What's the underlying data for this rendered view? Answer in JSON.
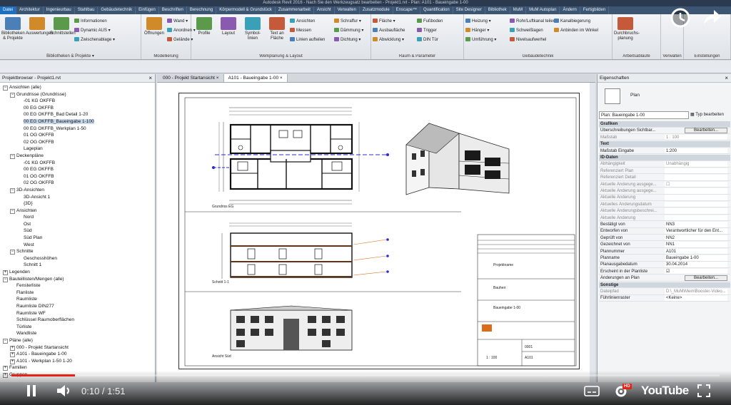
{
  "window": {
    "title": "Autodesk Revit 2016 - Nach Sie den Werkzeugsatz bearbeiten - Projekt1.rvt - Plan: A101 - Baueingabe 1-00"
  },
  "ribbon_tabs": [
    "Datei",
    "Architektur",
    "Ingenieurbau",
    "Stahlbau",
    "Gebäudetechnik",
    "Einfügen",
    "Beschriften",
    "Berechnung",
    "Körpermodell & Grundstück",
    "Zusammenarbeit",
    "Ansicht",
    "Verwalten",
    "Zusatzmodule",
    "Enscape™",
    "Quantification",
    "Site Designer",
    "Bibliothek",
    "MuM",
    "MuM Autoplan",
    "Ändern",
    "Fertigbilden"
  ],
  "ribbon": {
    "groups": [
      {
        "title": "Bibliotheken & Projekte ▾",
        "big": [
          "Bibliotheken & Projekte",
          "Auswertungen",
          "Schnittstellen"
        ],
        "small": [
          "Informationen",
          "Dynamic AUS ▾",
          "Zwischenablage ▾"
        ]
      },
      {
        "title": "Modellierung",
        "big": [
          "Öffnungen"
        ],
        "small": [
          "Wand ▾",
          "Anordnen ▾",
          "Gelände ▾"
        ]
      },
      {
        "title": "Werkplanung & Layout",
        "big": [
          "Profile",
          "Layout",
          "Symbol-linien",
          "Text an Fläche"
        ],
        "small": [
          "Ansichten",
          "Messen",
          "Linien aufteilen",
          "Schraffur ▾",
          "Dämmung ▾",
          "Dichtung ▾"
        ]
      },
      {
        "title": "Raum & Parameter",
        "big": [],
        "small": [
          "Fläche ▾",
          "Ausbaufläche",
          "Abwicklung ▾",
          "Fußboden",
          "Trigger",
          "DIN Tür"
        ]
      },
      {
        "title": "Gebäudetechnik",
        "big": [],
        "small": [
          "Heizung ▾",
          "Hänger ▾",
          "Umführung ▾",
          "Rohr/Luftkanal teilen",
          "Schweißlagen",
          "Nivelsaufwerhel",
          "Kanalbiegerung",
          "Anbinden im Winkel"
        ]
      },
      {
        "title": "Arbeitsabläufe",
        "big": [
          "Durchbruchs-planung"
        ],
        "small": []
      },
      {
        "title": "Verwalten",
        "big": [],
        "small": []
      },
      {
        "title": "Einstellungen",
        "big": [],
        "small": []
      }
    ]
  },
  "browser": {
    "title": "Projektbrowser - Projekt1.rvt",
    "items": [
      {
        "label": "Ansichten (alle)",
        "level": 0,
        "toggle": "−"
      },
      {
        "label": "Grundrisse (Grundrisse)",
        "level": 1,
        "toggle": "−"
      },
      {
        "label": "-01 KG OKFFB",
        "level": 2
      },
      {
        "label": "00 EG OKFFB",
        "level": 2
      },
      {
        "label": "00 EG OKFFB_Bad Detail 1-20",
        "level": 2
      },
      {
        "label": "00 EG OKFFB_Baueingabe 1-100",
        "level": 2,
        "selected": true
      },
      {
        "label": "00 EG OKFFB_Werkplan 1-50",
        "level": 2
      },
      {
        "label": "01 OG OKFFB",
        "level": 2
      },
      {
        "label": "02 OG OKFFB",
        "level": 2
      },
      {
        "label": "Lageplan",
        "level": 2
      },
      {
        "label": "Deckenpläne",
        "level": 1,
        "toggle": "−"
      },
      {
        "label": "-01 KG OKFFB",
        "level": 2
      },
      {
        "label": "00 EG OKFFB",
        "level": 2
      },
      {
        "label": "01 OG OKFFB",
        "level": 2
      },
      {
        "label": "02 OG OKFFB",
        "level": 2
      },
      {
        "label": "3D-Ansichten",
        "level": 1,
        "toggle": "−"
      },
      {
        "label": "3D-Ansicht 1",
        "level": 2
      },
      {
        "label": "{3D}",
        "level": 2
      },
      {
        "label": "Ansichten",
        "level": 1,
        "toggle": "−"
      },
      {
        "label": "Nord",
        "level": 2
      },
      {
        "label": "Ost",
        "level": 2
      },
      {
        "label": "Süd",
        "level": 2
      },
      {
        "label": "Süd Plan",
        "level": 2
      },
      {
        "label": "West",
        "level": 2
      },
      {
        "label": "Schnitte",
        "level": 1,
        "toggle": "−"
      },
      {
        "label": "Geschosshöhen",
        "level": 2
      },
      {
        "label": "Schnitt 1",
        "level": 2
      },
      {
        "label": "Legenden",
        "level": 0,
        "toggle": "+"
      },
      {
        "label": "Bauteillisten/Mengen (alle)",
        "level": 0,
        "toggle": "−"
      },
      {
        "label": "Fensterliste",
        "level": 1
      },
      {
        "label": "Flanliste",
        "level": 1
      },
      {
        "label": "Raumliste",
        "level": 1
      },
      {
        "label": "Raumliste DIN277",
        "level": 1
      },
      {
        "label": "Raumliste WF",
        "level": 1
      },
      {
        "label": "Schlüssel Raumoberflächen",
        "level": 1
      },
      {
        "label": "Türliste",
        "level": 1
      },
      {
        "label": "Wandliste",
        "level": 1
      },
      {
        "label": "Pläne (alle)",
        "level": 0,
        "toggle": "−"
      },
      {
        "label": "000 - Projekt Startansicht",
        "level": 1,
        "toggle": "+"
      },
      {
        "label": "A101 - Baueingabe 1-00",
        "level": 1,
        "toggle": "+"
      },
      {
        "label": "A101 - Werkplan 1-50 1-20",
        "level": 1,
        "toggle": "+"
      },
      {
        "label": "Familien",
        "level": 0,
        "toggle": "+"
      },
      {
        "label": "Gruppen",
        "level": 0,
        "toggle": "+"
      }
    ]
  },
  "view_tabs": [
    "000 - Projekt Startansicht",
    "A101 - Baueingabe 1-00"
  ],
  "sheet": {
    "grundriss_label": "Grundriss EG",
    "schnitt_label": "Schnitt 1-1",
    "ansicht_label": "Ansicht Süd",
    "titleblock": {
      "projekt": "Projektname",
      "bauherr": "Bauherr",
      "plan": "Baueingabe 1-00",
      "number": "0001",
      "sheet": "A101",
      "scale": "1 : 100"
    }
  },
  "properties": {
    "title": "Eigenschaften",
    "type_name": "Plan",
    "selector": "Plan: Baueingabe 1-00",
    "edit_type": "Typ bearbeiten",
    "rows": [
      {
        "k": "Grafiken",
        "cat": true
      },
      {
        "k": "Überschreibungen Sichtbar...",
        "btn": "Bearbeiten..."
      },
      {
        "k": "Maßstab",
        "v": "1 : 100",
        "grey": true
      },
      {
        "k": "Text",
        "cat": true
      },
      {
        "k": "Maßstab Eingabe",
        "v": "1:200"
      },
      {
        "k": "ID-Daten",
        "cat": true
      },
      {
        "k": "Abhängigkeit",
        "v": "Unabhängig",
        "grey": true
      },
      {
        "k": "Referenziert Plan",
        "v": "",
        "grey": true
      },
      {
        "k": "Referenziert Detail",
        "v": "",
        "grey": true
      },
      {
        "k": "Aktuelle Änderung ausgege...",
        "v": "☐",
        "grey": true
      },
      {
        "k": "Aktuelle Änderung ausgege...",
        "v": "",
        "grey": true
      },
      {
        "k": "Aktuelle Änderung",
        "v": "",
        "grey": true
      },
      {
        "k": "Aktuelles Änderungsdatum",
        "v": "",
        "grey": true
      },
      {
        "k": "Aktuelle Änderungsbeschrei...",
        "v": "",
        "grey": true
      },
      {
        "k": "Aktuelle Änderung",
        "v": "",
        "grey": true
      },
      {
        "k": "Bestätigt von",
        "v": "NN3"
      },
      {
        "k": "Entworfen von",
        "v": "Verantwortlicher für den Ent..."
      },
      {
        "k": "Geprüft von",
        "v": "NN2"
      },
      {
        "k": "Gezeichnet von",
        "v": "NN1"
      },
      {
        "k": "Plannummer",
        "v": "A101"
      },
      {
        "k": "Planname",
        "v": "Baueingabe 1-00"
      },
      {
        "k": "Planausgabedatum",
        "v": "30.04.2014"
      },
      {
        "k": "Erscheint in der Planliste",
        "v": "☑"
      },
      {
        "k": "Änderungen an Plan",
        "btn": "Bearbeiten..."
      },
      {
        "k": "Sonstige",
        "cat": true
      },
      {
        "k": "Dateipfad",
        "v": "D:\\_MuM\\Mein\\Booster-Video...",
        "grey": true
      },
      {
        "k": "Führlinienraster",
        "v": "<Keine>"
      }
    ]
  },
  "player": {
    "time_current": "0:10",
    "time_total": "1:51",
    "time_sep": " / ",
    "progress": 0.09,
    "brand": "YouTube",
    "hd": "HD"
  }
}
